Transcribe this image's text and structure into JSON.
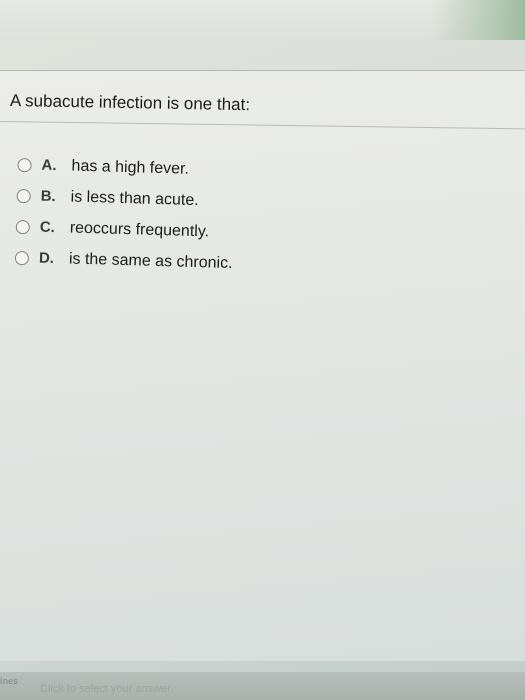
{
  "question": {
    "prompt": "A subacute infection is one that:",
    "choices": [
      {
        "letter": "A.",
        "text": "has a high fever."
      },
      {
        "letter": "B.",
        "text": "is less than acute."
      },
      {
        "letter": "C.",
        "text": "reoccurs frequently."
      },
      {
        "letter": "D.",
        "text": "is the same as chronic."
      }
    ]
  },
  "footer": {
    "cut_text": "ines",
    "hint": "Click to select your answer."
  }
}
